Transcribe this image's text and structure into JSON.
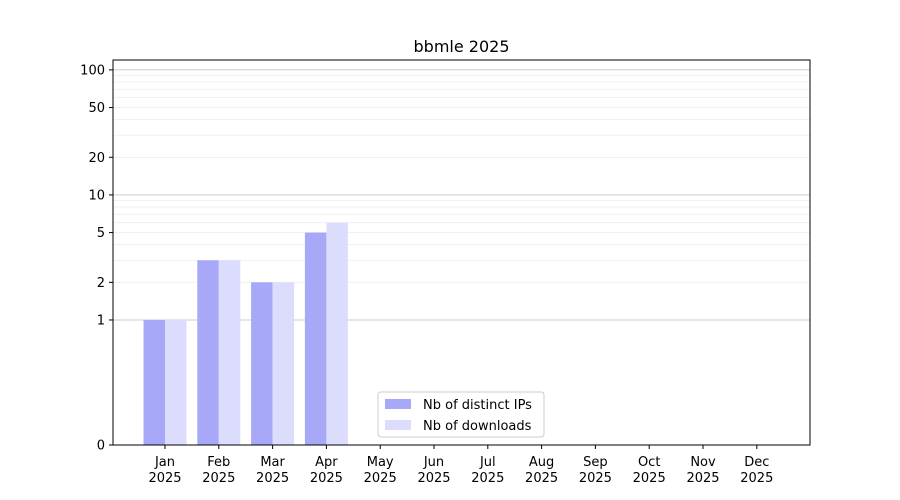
{
  "chart_data": {
    "type": "bar",
    "title": "bbmle 2025",
    "xlabel": "",
    "ylabel": "",
    "categories": [
      [
        "Jan",
        "2025"
      ],
      [
        "Feb",
        "2025"
      ],
      [
        "Mar",
        "2025"
      ],
      [
        "Apr",
        "2025"
      ],
      [
        "May",
        "2025"
      ],
      [
        "Jun",
        "2025"
      ],
      [
        "Jul",
        "2025"
      ],
      [
        "Aug",
        "2025"
      ],
      [
        "Sep",
        "2025"
      ],
      [
        "Oct",
        "2025"
      ],
      [
        "Nov",
        "2025"
      ],
      [
        "Dec",
        "2025"
      ]
    ],
    "series": [
      {
        "name": "Nb of distinct IPs",
        "color": "#a8a8f8",
        "values": [
          1,
          3,
          2,
          5,
          0,
          0,
          0,
          0,
          0,
          0,
          0,
          0
        ]
      },
      {
        "name": "Nb of downloads",
        "color": "#dcdcfc",
        "values": [
          1,
          3,
          2,
          6,
          0,
          0,
          0,
          0,
          0,
          0,
          0,
          0
        ]
      }
    ],
    "yscale": "symlog",
    "ylim": [
      0,
      120
    ],
    "yticks": [
      0,
      1,
      2,
      5,
      10,
      20,
      50,
      100
    ],
    "major_grid": [
      1,
      10,
      100
    ],
    "legend_position": "lower-center",
    "grid": true
  }
}
